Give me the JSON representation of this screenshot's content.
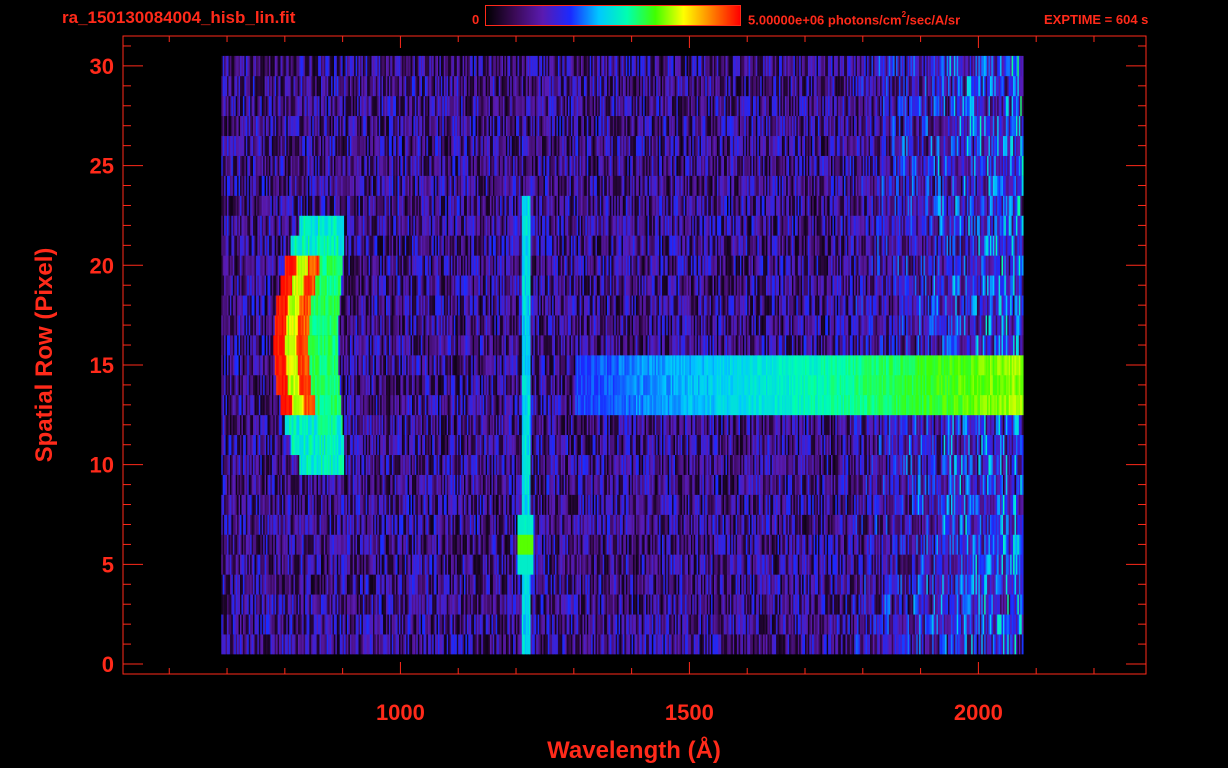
{
  "header": {
    "filename": "ra_150130084004_hisb_lin.fit",
    "colorbar_min": "0",
    "colorbar_max": "5.00000e+06 photons/cm",
    "colorbar_max_exp": "2",
    "colorbar_max_unit": "/sec/A/sr",
    "exptime": "EXPTIME = 604 s"
  },
  "colors": {
    "axes": "#ff2a1a",
    "background": "#000000",
    "colormap": [
      "#000000",
      "#3a0a55",
      "#5a1ab0",
      "#1a2aff",
      "#00c8ff",
      "#00ffb0",
      "#40ff00",
      "#ffff00",
      "#ff8000",
      "#ff0000"
    ]
  },
  "chart_data": {
    "type": "heatmap",
    "title": "ra_150130084004_hisb_lin.fit",
    "xlabel": "Wavelength (Å)",
    "ylabel": "Spatial Row (Pixel)",
    "xlim": [
      520,
      2290
    ],
    "ylim": [
      -0.5,
      31.5
    ],
    "xticks": [
      1000,
      1500,
      2000
    ],
    "xtick_labels": [
      "1000",
      "1500",
      "2000"
    ],
    "yticks": [
      0,
      5,
      10,
      15,
      20,
      25,
      30
    ],
    "ytick_labels": [
      "0",
      "5",
      "10",
      "15",
      "20",
      "25",
      "30"
    ],
    "colorbar_range": [
      0,
      5000000
    ],
    "colorbar_unit": "photons/cm^2/sec/A/sr",
    "features": [
      {
        "name": "emission blob",
        "x_range": [
          780,
          920
        ],
        "y_range": [
          10,
          22
        ],
        "peak_x": 790,
        "peak_rows": [
          13,
          20
        ],
        "level": "high"
      },
      {
        "name": "vertical line",
        "x": 1216,
        "y_range": [
          1,
          23
        ],
        "level": "medium"
      },
      {
        "name": "line peak",
        "x": 1216,
        "y_range": [
          5,
          7
        ],
        "level": "high"
      },
      {
        "name": "continuum band",
        "x_range": [
          1500,
          2075
        ],
        "y_range": [
          13,
          15
        ],
        "level": "medium-high"
      },
      {
        "name": "noise region",
        "x_range": [
          690,
          2075
        ],
        "y_range": [
          3,
          30
        ],
        "level": "low"
      }
    ]
  }
}
